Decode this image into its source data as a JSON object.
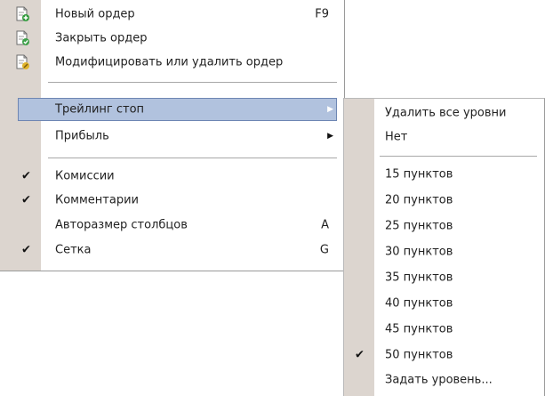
{
  "main_menu": {
    "new_order": {
      "label": "Новый ордер",
      "shortcut": "F9",
      "icon": "new-order-icon"
    },
    "close_order": {
      "label": "Закрыть ордер",
      "icon": "close-order-icon"
    },
    "modify_order": {
      "label": "Модифицировать или удалить ордер",
      "icon": "modify-order-icon"
    },
    "trailing_stop": {
      "label": "Трейлинг стоп",
      "highlighted": true
    },
    "profit": {
      "label": "Прибыль"
    },
    "commissions": {
      "label": "Комиссии",
      "checked": true
    },
    "comments": {
      "label": "Комментарии",
      "checked": true
    },
    "autosize": {
      "label": "Авторазмер столбцов",
      "shortcut": "A"
    },
    "grid": {
      "label": "Сетка",
      "shortcut": "G",
      "checked": true
    }
  },
  "trailing_submenu": {
    "delete_all": "Удалить все уровни",
    "none": "Нет",
    "levels": [
      {
        "label": "15 пунктов",
        "checked": false
      },
      {
        "label": "20 пунктов",
        "checked": false
      },
      {
        "label": "25 пунктов",
        "checked": false
      },
      {
        "label": "30 пунктов",
        "checked": false
      },
      {
        "label": "35 пунктов",
        "checked": false
      },
      {
        "label": "40 пунктов",
        "checked": false
      },
      {
        "label": "45 пунктов",
        "checked": false
      },
      {
        "label": "50 пунктов",
        "checked": true
      }
    ],
    "set_level": "Задать уровень..."
  },
  "colors": {
    "gutter": "#dcd5cf",
    "highlight_fill": "#b1c2de",
    "highlight_border": "#6e86b3"
  }
}
